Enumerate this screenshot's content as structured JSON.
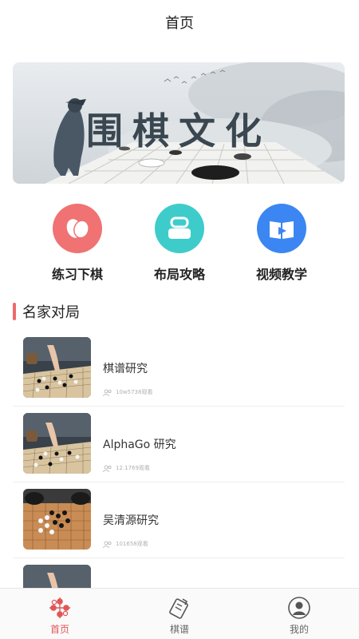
{
  "header": {
    "title": "首页"
  },
  "banner": {
    "text": "围棋文化"
  },
  "shortcuts": [
    {
      "label": "练习下棋",
      "icon": "stones-icon",
      "color": "#f07272"
    },
    {
      "label": "布局攻略",
      "icon": "stones-stack-icon",
      "color": "#3ecccb"
    },
    {
      "label": "视频教学",
      "icon": "video-book-icon",
      "color": "#3b86f2"
    }
  ],
  "section": {
    "title": "名家对局"
  },
  "games": [
    {
      "title": "棋谱研究",
      "meta": "10w5738观看"
    },
    {
      "title": "AlphaGo 研究",
      "meta": "12.1769观看"
    },
    {
      "title": "吴清源研究",
      "meta": "101658观看"
    },
    {
      "title": "",
      "meta": ""
    }
  ],
  "tabbar": [
    {
      "label": "首页",
      "icon": "home-go-icon",
      "active": true
    },
    {
      "label": "棋谱",
      "icon": "notebook-icon",
      "active": false
    },
    {
      "label": "我的",
      "icon": "profile-icon",
      "active": false
    }
  ],
  "colors": {
    "accent": "#ef6a6a",
    "tab_active": "#e25656"
  }
}
